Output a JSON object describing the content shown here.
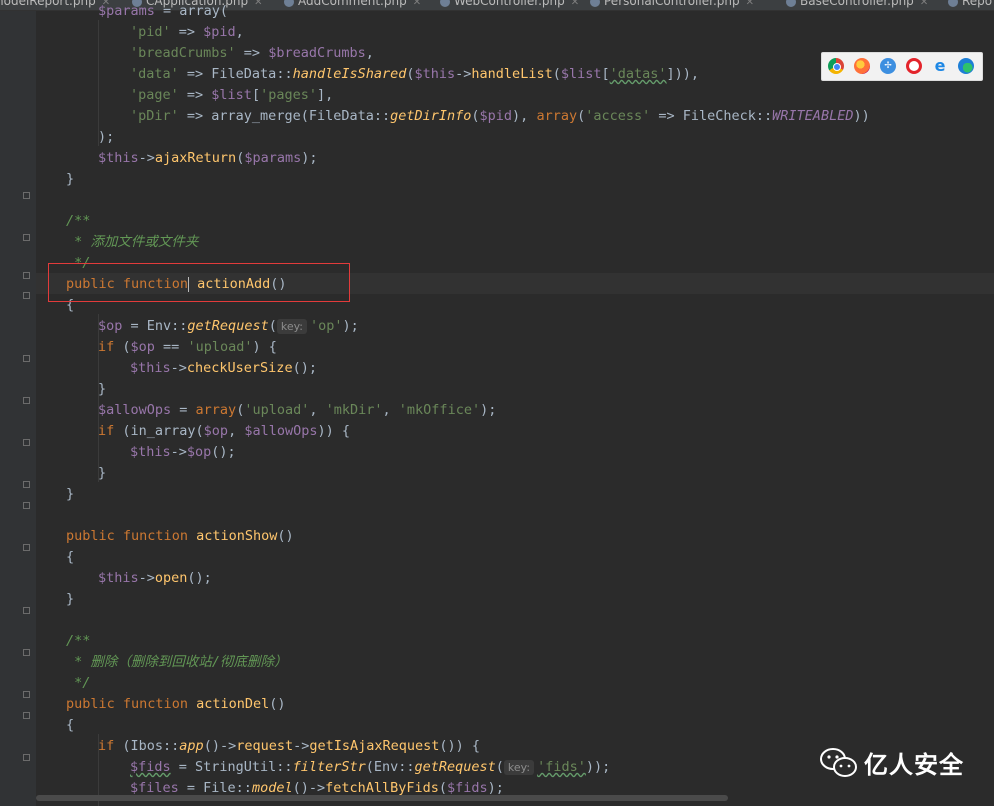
{
  "tabs": [
    {
      "label": "nodelReport.php"
    },
    {
      "label": "CApplication.php"
    },
    {
      "label": "AddComment.php"
    },
    {
      "label": "WebController.php"
    },
    {
      "label": "PersonalController.php",
      "active": true
    },
    {
      "label": "BaseController.php"
    },
    {
      "label": "Repo"
    }
  ],
  "browser_icons": [
    "chrome-icon",
    "firefox-icon",
    "safari-icon",
    "opera-icon",
    "ie-icon",
    "edge-icon"
  ],
  "watermark": {
    "text": "亿人安全"
  },
  "code": {
    "l0_var": "$params",
    "l0_rest": " = array(",
    "l1_key": "'pid'",
    "l1_arrow": " => ",
    "l1_var": "$pid",
    "l1_end": ",",
    "l2_key": "'breadCrumbs'",
    "l2_arrow": " => ",
    "l2_var": "$breadCrumbs",
    "l2_end": ",",
    "l3_key": "'data'",
    "l3_a": " => FileData::",
    "l3_fn": "handleIsShared",
    "l3_b": "(",
    "l3_this": "$this",
    "l3_c": "->",
    "l3_fn2": "handleList",
    "l3_d": "(",
    "l3_var": "$list",
    "l3_e": "[",
    "l3_key2": "'datas'",
    "l3_f": "])),",
    "l4_key": "'page'",
    "l4_a": " => ",
    "l4_var": "$list",
    "l4_b": "[",
    "l4_key2": "'pages'",
    "l4_c": "],",
    "l5_key": "'pDir'",
    "l5_a": " => array_merge(FileData::",
    "l5_fn": "getDirInfo",
    "l5_b": "(",
    "l5_var": "$pid",
    "l5_c": "), ",
    "l5_kw": "array",
    "l5_d": "(",
    "l5_key2": "'access'",
    "l5_e": " => FileCheck::",
    "l5_const": "WRITEABLED",
    "l5_f": "))",
    "l6": ");",
    "l7_this": "$this",
    "l7_a": "->",
    "l7_fn": "ajaxReturn",
    "l7_b": "(",
    "l7_var": "$params",
    "l7_c": ");",
    "l8": "}",
    "l9": "/**",
    "l10": " * 添加文件或文件夹",
    "l11": " */",
    "l12_kw1": "public",
    "l12_kw2": "function",
    "l12_fn": "actionAdd",
    "l12_end": "()",
    "l13": "{",
    "l14_var": "$op",
    "l14_a": " = Env::",
    "l14_fn": "getRequest",
    "l14_b": "(",
    "l14_hint": "key:",
    "l14_str": "'op'",
    "l14_c": ");",
    "l15_kw": "if",
    "l15_a": " (",
    "l15_var": "$op",
    "l15_b": " == ",
    "l15_str": "'upload'",
    "l15_c": ") {",
    "l16_this": "$this",
    "l16_a": "->",
    "l16_fn": "checkUserSize",
    "l16_b": "();",
    "l17": "}",
    "l18_var": "$allowOps",
    "l18_a": " = ",
    "l18_kw": "array",
    "l18_b": "(",
    "l18_s1": "'upload'",
    "l18_c": ", ",
    "l18_s2": "'mkDir'",
    "l18_d": ", ",
    "l18_s3": "'mkOffice'",
    "l18_e": ");",
    "l19_kw": "if",
    "l19_a": " (in_array(",
    "l19_v1": "$op",
    "l19_b": ", ",
    "l19_v2": "$allowOps",
    "l19_c": ")) {",
    "l20_this": "$this",
    "l20_a": "->",
    "l20_var": "$op",
    "l20_b": "();",
    "l21": "}",
    "l22": "}",
    "l23_kw1": "public",
    "l23_kw2": "function",
    "l23_fn": "actionShow",
    "l23_end": "()",
    "l24": "{",
    "l25_this": "$this",
    "l25_a": "->",
    "l25_fn": "open",
    "l25_b": "();",
    "l26": "}",
    "l27": "/**",
    "l28": " * 删除（删除到回收站/彻底删除）",
    "l29": " */",
    "l30_kw1": "public",
    "l30_kw2": "function",
    "l30_fn": "actionDel",
    "l30_end": "()",
    "l31": "{",
    "l32_kw": "if",
    "l32_a": " (Ibos::",
    "l32_fn": "app",
    "l32_b": "()->",
    "l32_fn2": "request",
    "l32_c": "->",
    "l32_fn3": "getIsAjaxRequest",
    "l32_d": "()) {",
    "l33_var": "$fids",
    "l33_a": " = StringUtil::",
    "l33_fn": "filterStr",
    "l33_b": "(Env::",
    "l33_fn2": "getRequest",
    "l33_c": "(",
    "l33_hint": "key:",
    "l33_str": "'fids'",
    "l33_d": "));",
    "l34_var": "$files",
    "l34_a": " = File::",
    "l34_fn": "model",
    "l34_b": "()->",
    "l34_fn2": "fetchAllByFids",
    "l34_c": "(",
    "l34_var2": "$fids",
    "l34_d": ");"
  }
}
